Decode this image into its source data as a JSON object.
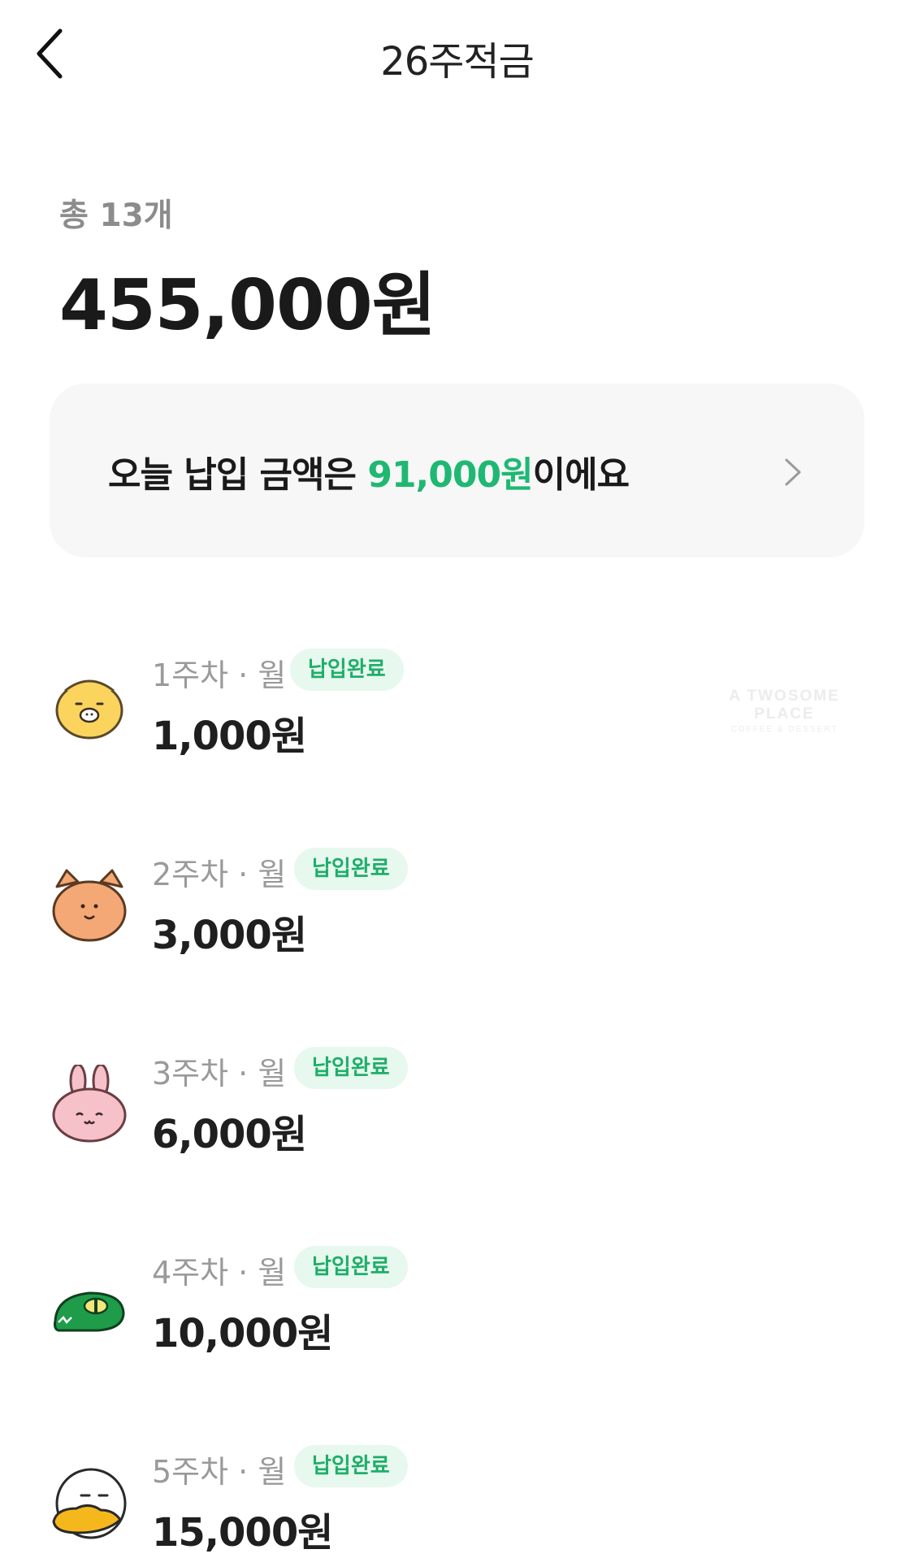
{
  "nav": {
    "title": "26주적금"
  },
  "summary": {
    "count_label": "총 13개",
    "total_amount": "455,000원"
  },
  "today": {
    "prefix": "오늘 납입 금액은 ",
    "amount": "91,000원",
    "suffix": "이에요"
  },
  "watermark": {
    "brand": "A TWOSOME PLACE",
    "tagline": "COFFEE & DESSERT"
  },
  "payments": [
    {
      "week": "1주차 · 월",
      "status": "납입완료",
      "amount": "1,000원",
      "character": "lion-character-icon"
    },
    {
      "week": "2주차 · 월",
      "status": "납입완료",
      "amount": "3,000원",
      "character": "tiger-character-icon"
    },
    {
      "week": "3주차 · 월",
      "status": "납입완료",
      "amount": "6,000원",
      "character": "rabbit-character-icon"
    },
    {
      "week": "4주차 · 월",
      "status": "납입완료",
      "amount": "10,000원",
      "character": "crocodile-character-icon"
    },
    {
      "week": "5주차 · 월",
      "status": "납입완료",
      "amount": "15,000원",
      "character": "duck-character-icon"
    }
  ],
  "colors": {
    "accent": "#1fb872",
    "badge_bg": "#e7f8ee",
    "badge_text": "#1fae6a",
    "card_bg": "#f7f7f7"
  }
}
